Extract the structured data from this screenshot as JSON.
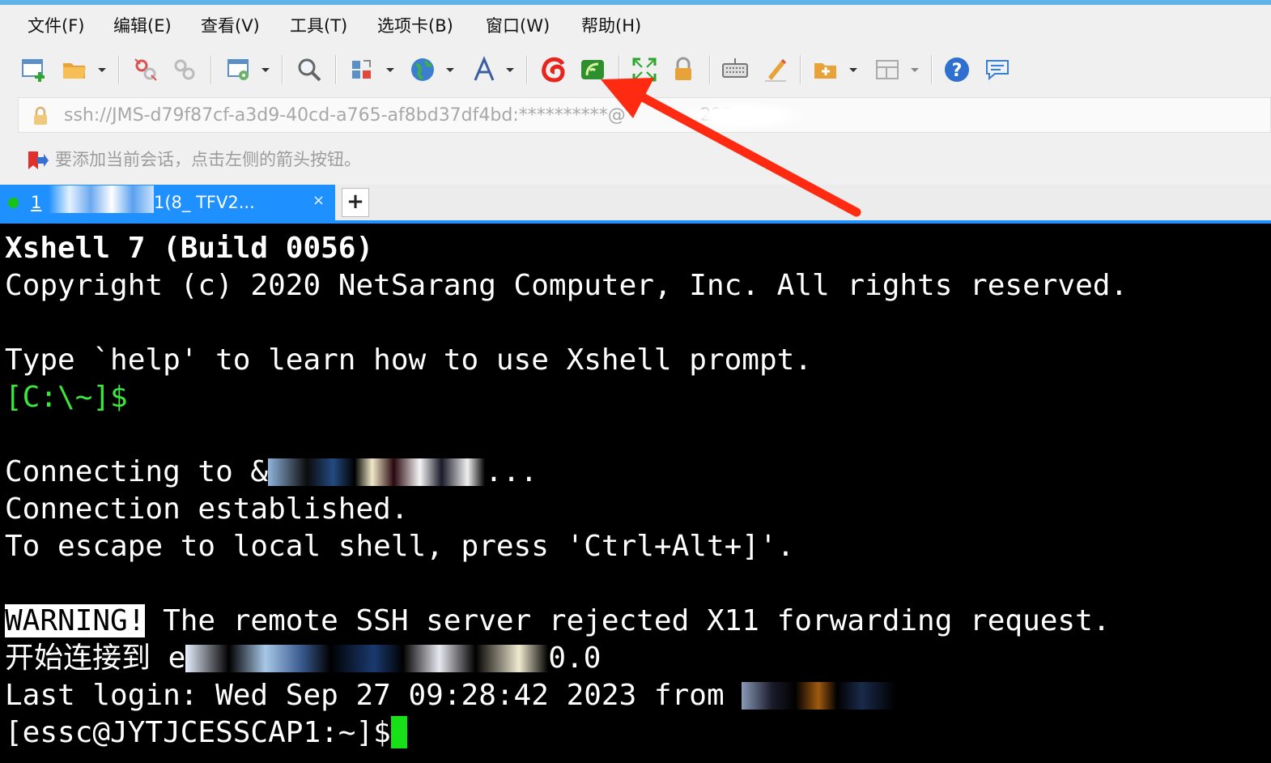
{
  "menu": [
    "文件(F)",
    "编辑(E)",
    "查看(V)",
    "工具(T)",
    "选项卡(B)",
    "窗口(W)",
    "帮助(H)"
  ],
  "toolbar": {
    "buttons": [
      "new-session",
      "open",
      "disconnect",
      "reconnect",
      "properties",
      "find",
      "transfer",
      "globe",
      "font",
      "xftp",
      "xmanager",
      "fullscreen",
      "lock",
      "keyboard",
      "highlight",
      "new-folder",
      "layout",
      "help",
      "chat"
    ]
  },
  "address": {
    "text": "ssh://JMS-d79f87cf-a3d9-40cd-a765-af8bd37df4bd:**********@",
    "suffix": "222"
  },
  "hint": {
    "text": "要添加当前会话，点击左侧的箭头按钮。"
  },
  "tab": {
    "number": "1",
    "title": "1(8_ TFV2...",
    "close": "×",
    "new_tab": "+"
  },
  "terminal": {
    "banner_title": "Xshell 7 (Build 0056)",
    "copyright": "Copyright (c) 2020 NetSarang Computer, Inc. All rights reserved.",
    "help_line": "Type `help' to learn how to use Xshell prompt.",
    "local_prompt": "[C:\\~]$",
    "connecting_prefix": "Connecting to &",
    "connecting_suffix": "...",
    "established": "Connection established.",
    "escape_hint": "To escape to local shell, press 'Ctrl+Alt+]'.",
    "warning_label": "WARNING!",
    "warning_text": " The remote SSH server rejected X11 forwarding request.",
    "connect_cn_prefix": "开始连接到 e",
    "connect_cn_suffix": "0.0",
    "last_login_prefix": "Last login: Wed Sep 27 09:28:42 2023 from ",
    "remote_prompt": "[essc@JYTJCESSCAP1:~]$"
  },
  "colors": {
    "tab_active": "#1e90ff",
    "prompt_green": "#3de63d",
    "cursor": "#18e018",
    "arrow": "#ff2a12"
  }
}
